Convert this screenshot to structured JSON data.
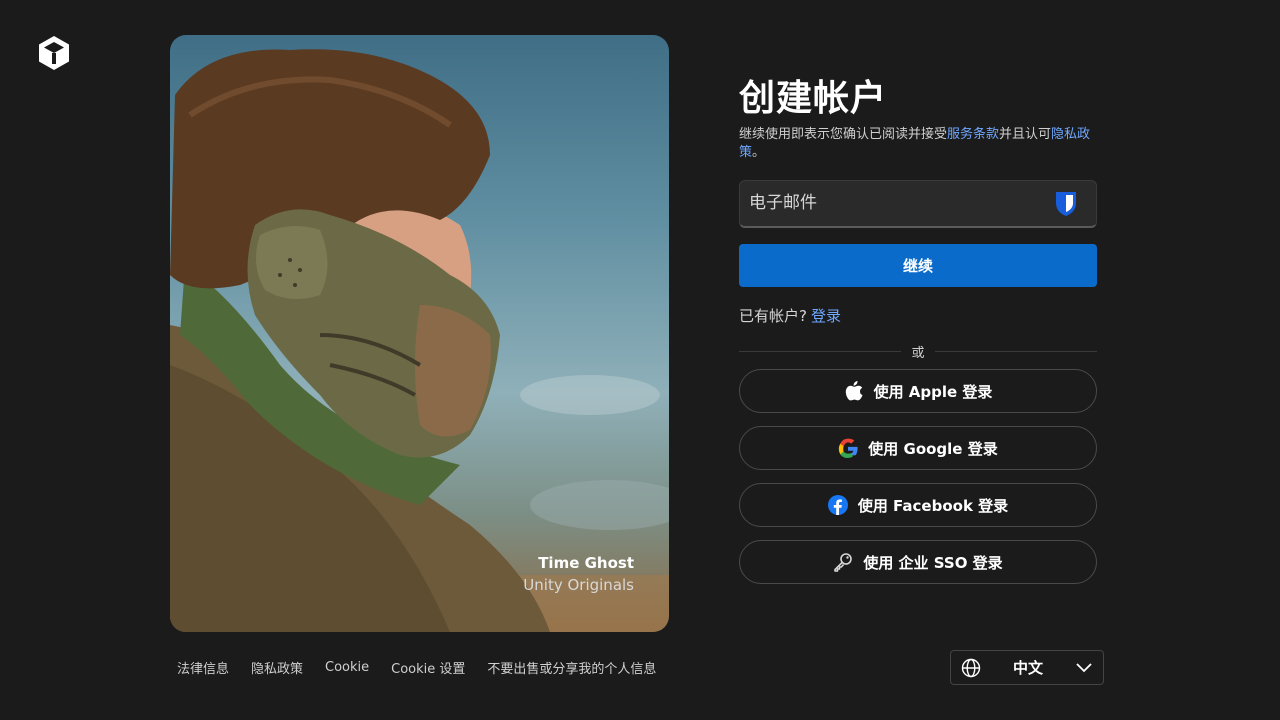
{
  "brand": {
    "logo_icon": "unity-logo-icon"
  },
  "hero": {
    "caption_title": "Time Ghost",
    "caption_subtitle": "Unity Originals"
  },
  "form": {
    "title": "创建帐户",
    "desc_prefix": "继续使用即表示您确认已阅读并接受",
    "terms_link": "服务条款",
    "desc_middle": "并且认可",
    "privacy_link": "隐私政策",
    "desc_suffix": "。",
    "email_placeholder": "电子邮件",
    "password_manager_icon": "bitwarden-shield-icon",
    "continue_label": "继续",
    "have_account_text": "已有帐户?",
    "login_link": "登录",
    "or_text": "或"
  },
  "social": [
    {
      "icon": "apple-icon",
      "label": "使用 Apple 登录"
    },
    {
      "icon": "google-icon",
      "label": "使用 Google 登录"
    },
    {
      "icon": "facebook-icon",
      "label": "使用 Facebook 登录"
    },
    {
      "icon": "key-icon",
      "label": "使用 企业 SSO 登录"
    }
  ],
  "footer": {
    "links": [
      "法律信息",
      "隐私政策",
      "Cookie",
      "Cookie 设置",
      "不要出售或分享我的个人信息"
    ]
  },
  "language": {
    "selected": "中文",
    "icon": "globe-icon"
  },
  "colors": {
    "background": "#1b1b1b",
    "primary_button": "#0b6bcb",
    "link": "#6fa8ff"
  }
}
